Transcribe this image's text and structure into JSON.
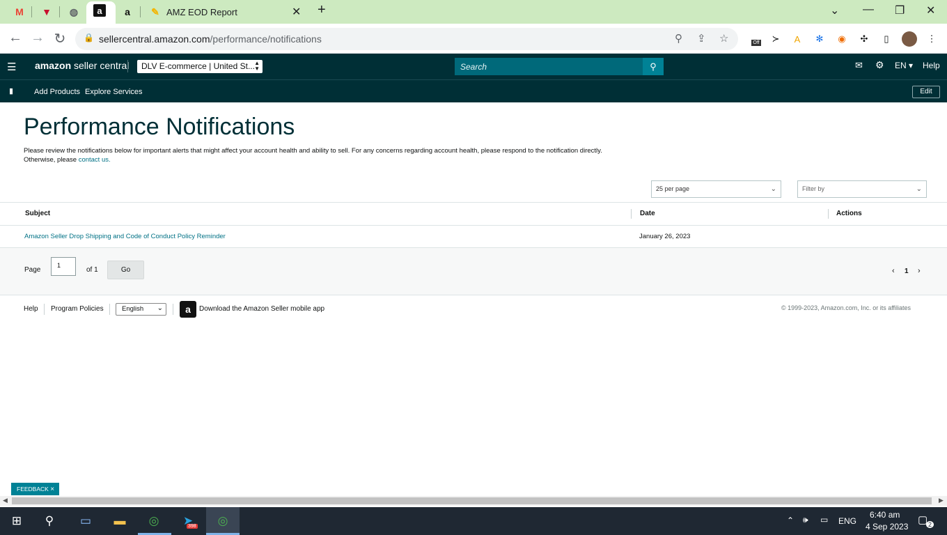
{
  "browser": {
    "active_tab_title": "AMZ EOD Report",
    "url_host": "sellercentral.amazon.com",
    "url_path": "/performance/notifications",
    "extension_badge": "Off"
  },
  "seller_central": {
    "logo_bold": "amazon",
    "logo_rest": "seller central",
    "account_selector": "DLV E-commerce | United St...",
    "search_placeholder": "Search",
    "language": "EN",
    "help": "Help",
    "nav_links": [
      "Add Products",
      "Explore Services"
    ],
    "edit": "Edit"
  },
  "page": {
    "title": "Performance Notifications",
    "description_line1": "Please review the notifications below for important alerts that might affect your account health and ability to sell. For any concerns regarding account health, please respond to the notification directly.",
    "description_line2_prefix": "Otherwise, please ",
    "contact_link": "contact us.",
    "per_page": "25 per page",
    "filter_placeholder": "Filter by"
  },
  "table": {
    "columns": [
      "Subject",
      "Date",
      "Actions"
    ],
    "rows": [
      {
        "subject": "Amazon Seller Drop Shipping and Code of Conduct Policy Reminder",
        "date": "January 26, 2023",
        "actions": ""
      }
    ]
  },
  "pagination": {
    "page_label": "Page",
    "current": "1",
    "of_label": "of 1",
    "go": "Go",
    "nav_page": "1"
  },
  "footer": {
    "help": "Help",
    "program_policies": "Program Policies",
    "language_option": "English",
    "app_text": "Download the Amazon Seller mobile app",
    "copyright": "© 1999-2023, Amazon.com, Inc. or its affiliates"
  },
  "feedback": {
    "label": "FEEDBACK",
    "close": "×"
  },
  "taskbar": {
    "language": "ENG",
    "time": "6:40 am",
    "date": "4 Sep 2023",
    "telegram_badge": "398",
    "notification_count": "2"
  },
  "colors": {
    "header_bg": "#002f36",
    "link": "#007185",
    "search_bg": "#00697a",
    "accent": "#008296",
    "tab_bar_bg": "#cdeac0"
  }
}
